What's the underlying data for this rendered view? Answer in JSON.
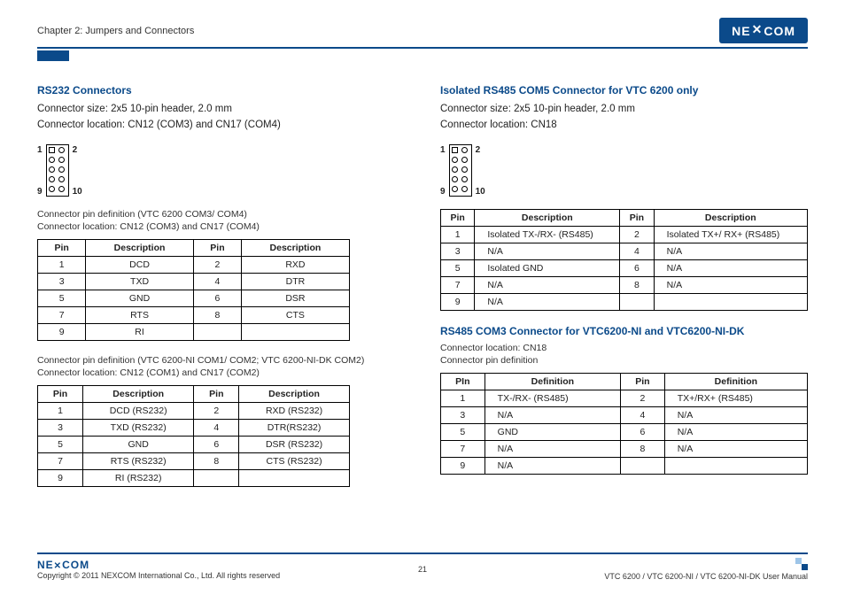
{
  "header": {
    "chapter": "Chapter 2: Jumpers and Connectors",
    "logo_text": "NEXCOM"
  },
  "left": {
    "title": "RS232 Connectors",
    "size": "Connector size:  2x5 10-pin header, 2.0 mm",
    "loc": "Connector location: CN12 (COM3) and CN17 (COM4)",
    "pins": {
      "tl": "1",
      "tr": "2",
      "bl": "9",
      "br": "10"
    },
    "tbl1_cap1": "Connector pin definition (VTC 6200 COM3/ COM4)",
    "tbl1_cap2": "Connector location: CN12 (COM3) and CN17 (COM4)",
    "tbl1_h": {
      "pin": "Pin",
      "desc": "Description"
    },
    "tbl1": [
      {
        "p1": "1",
        "d1": "DCD",
        "p2": "2",
        "d2": "RXD"
      },
      {
        "p1": "3",
        "d1": "TXD",
        "p2": "4",
        "d2": "DTR"
      },
      {
        "p1": "5",
        "d1": "GND",
        "p2": "6",
        "d2": "DSR"
      },
      {
        "p1": "7",
        "d1": "RTS",
        "p2": "8",
        "d2": "CTS"
      },
      {
        "p1": "9",
        "d1": "RI",
        "p2": "",
        "d2": ""
      }
    ],
    "tbl2_cap1": "Connector pin definition (VTC 6200-NI COM1/ COM2; VTC 6200-NI-DK COM2)",
    "tbl2_cap2": "Connector location: CN12 (COM1) and CN17 (COM2)",
    "tbl2": [
      {
        "p1": "1",
        "d1": "DCD (RS232)",
        "p2": "2",
        "d2": "RXD (RS232)"
      },
      {
        "p1": "3",
        "d1": "TXD (RS232)",
        "p2": "4",
        "d2": "DTR(RS232)"
      },
      {
        "p1": "5",
        "d1": "GND",
        "p2": "6",
        "d2": "DSR (RS232)"
      },
      {
        "p1": "7",
        "d1": "RTS (RS232)",
        "p2": "8",
        "d2": "CTS (RS232)"
      },
      {
        "p1": "9",
        "d1": "RI (RS232)",
        "p2": "",
        "d2": ""
      }
    ]
  },
  "right": {
    "title1": "Isolated RS485 COM5 Connector for VTC 6200 only",
    "size": "Connector size:  2x5 10-pin header, 2.0 mm",
    "loc": "Connector location: CN18",
    "pins": {
      "tl": "1",
      "tr": "2",
      "bl": "9",
      "br": "10"
    },
    "tbl1_h": {
      "pin": "Pin",
      "desc": "Description"
    },
    "tbl1": [
      {
        "p1": "1",
        "d1": "Isolated TX-/RX- (RS485)",
        "p2": "2",
        "d2": "Isolated TX+/ RX+ (RS485)"
      },
      {
        "p1": "3",
        "d1": "N/A",
        "p2": "4",
        "d2": "N/A"
      },
      {
        "p1": "5",
        "d1": "Isolated GND",
        "p2": "6",
        "d2": "N/A"
      },
      {
        "p1": "7",
        "d1": "N/A",
        "p2": "8",
        "d2": "N/A"
      },
      {
        "p1": "9",
        "d1": "N/A",
        "p2": "",
        "d2": ""
      }
    ],
    "title2": "RS485 COM3 Connector for VTC6200-NI and VTC6200-NI-DK",
    "tbl2_cap1": "Connector location: CN18",
    "tbl2_cap2": "Connector pin definition",
    "tbl2_h": {
      "pin": "PIn",
      "desc": "Definition",
      "pin2": "Pin"
    },
    "tbl2": [
      {
        "p1": "1",
        "d1": "TX-/RX- (RS485)",
        "p2": "2",
        "d2": "TX+/RX+ (RS485)"
      },
      {
        "p1": "3",
        "d1": "N/A",
        "p2": "4",
        "d2": "N/A"
      },
      {
        "p1": "5",
        "d1": "GND",
        "p2": "6",
        "d2": "N/A"
      },
      {
        "p1": "7",
        "d1": "N/A",
        "p2": "8",
        "d2": "N/A"
      },
      {
        "p1": "9",
        "d1": "N/A",
        "p2": "",
        "d2": ""
      }
    ]
  },
  "footer": {
    "logo": "NEXCOM",
    "copyright": "Copyright © 2011 NEXCOM International Co., Ltd. All rights reserved",
    "page": "21",
    "manual": "VTC 6200 / VTC 6200-NI / VTC 6200-NI-DK User Manual"
  }
}
